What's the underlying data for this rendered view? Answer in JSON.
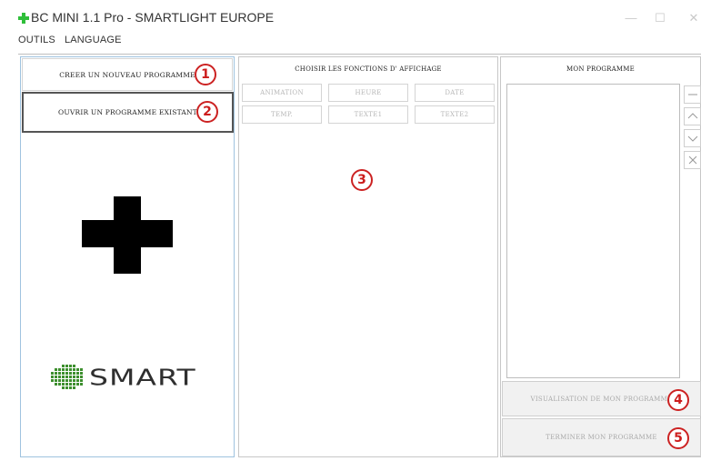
{
  "window": {
    "title": "BC MINI 1.1 Pro - SMARTLIGHT EUROPE",
    "minimize_glyph": "—",
    "maximize_glyph": "☐",
    "close_glyph": "✕"
  },
  "menu": [
    {
      "label": "OUTILS"
    },
    {
      "label": "LANGUAGE"
    }
  ],
  "left_panel": {
    "create_button": "CREER UN NOUVEAU PROGRAMME",
    "open_button": "OUVRIR UN PROGRAMME EXISTANT",
    "logo_text": "SMART"
  },
  "middle_panel": {
    "title": "CHOISIR LES FONCTIONS D' AFFICHAGE",
    "functions": [
      "ANIMATION",
      "HEURE",
      "DATE",
      "TEMP.",
      "TEXTE1",
      "TEXTE2"
    ]
  },
  "right_panel": {
    "title": "MON PROGRAMME",
    "side_buttons": [
      "minus-icon",
      "chevron-up-icon",
      "chevron-down-icon",
      "close-icon"
    ],
    "preview_button": "VISUALISATION DE MON PROGRAMME",
    "finish_button": "TERMINER MON PROGRAMME"
  },
  "callouts": [
    "1",
    "2",
    "3",
    "4",
    "5"
  ],
  "colors": {
    "accent_green": "#2fbf3a",
    "callout_red": "#cc2222",
    "left_panel_border": "#9fc3df",
    "disabled_text": "#b6b6b6"
  }
}
